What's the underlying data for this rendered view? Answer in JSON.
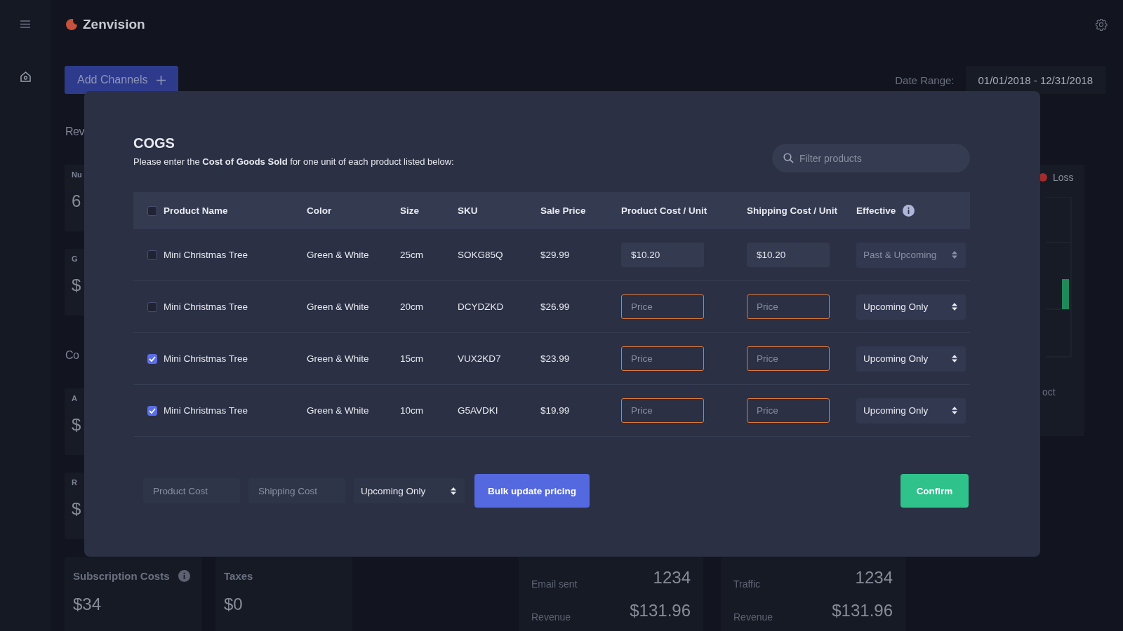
{
  "brand": "Zenvision",
  "toolbar": {
    "add_button": "Add Channels",
    "date_label": "Date Range:",
    "date_value": "01/01/2018 - 12/31/2018"
  },
  "left_column": [
    {
      "kind": "heading",
      "text": "Rev"
    },
    {
      "kind": "card",
      "label": "Nu",
      "value": "6"
    },
    {
      "kind": "card",
      "label": "G",
      "value": "$"
    },
    {
      "kind": "heading",
      "text": "Co"
    },
    {
      "kind": "card",
      "label": "A",
      "value": "$"
    },
    {
      "kind": "card",
      "label": "R",
      "value": "$"
    }
  ],
  "right_card": {
    "legend": "Loss",
    "axis_label": "oct"
  },
  "bottom_cards": [
    {
      "kind": "single",
      "title": "Subscription Costs",
      "info": true,
      "value": "$34"
    },
    {
      "kind": "single",
      "title": "Taxes",
      "info": false,
      "value": "$0"
    },
    {
      "kind": "pair",
      "label_1": "Email sent",
      "value_1": "1234",
      "label_2": "Revenue",
      "value_2": "$131.96"
    },
    {
      "kind": "pair",
      "label_1": "Traffic",
      "value_1": "1234",
      "label_2": "Revenue",
      "value_2": "$131.96"
    }
  ],
  "modal": {
    "title": "COGS",
    "subtitle": "Please enter the **Cost of Goods Sold** for one unit of each product listed below:",
    "filter_placeholder": "Filter products",
    "header_checked": false,
    "columns": [
      {
        "label": "Product Name",
        "info": false
      },
      {
        "label": "Color",
        "info": false
      },
      {
        "label": "Size",
        "info": false
      },
      {
        "label": "SKU",
        "info": false
      },
      {
        "label": "Sale Price",
        "info": false
      },
      {
        "label": "Product Cost / Unit",
        "info": false
      },
      {
        "label": "Shipping Cost / Unit",
        "info": false
      },
      {
        "label": "Effective",
        "info": true
      }
    ],
    "rows": [
      {
        "selected": false,
        "name": "Mini Christmas Tree",
        "color_label": "Green & White",
        "size": "25cm",
        "sku": "SOKG85Q",
        "sale_price": "$29.99",
        "product_cost": {
          "value": "$10.20",
          "invalid": false
        },
        "shipping_cost": {
          "value": "$10.20",
          "invalid": false
        },
        "effective": {
          "value": "Past & Upcoming",
          "disabled": true
        }
      },
      {
        "selected": false,
        "name": "Mini Christmas Tree",
        "color_label": "Green & White",
        "size": "20cm",
        "sku": "DCYDZKD",
        "sale_price": "$26.99",
        "product_cost": {
          "placeholder": "Price",
          "invalid": true
        },
        "shipping_cost": {
          "placeholder": "Price",
          "invalid": true
        },
        "effective": {
          "value": "Upcoming Only",
          "disabled": false
        }
      },
      {
        "selected": true,
        "name": "Mini Christmas Tree",
        "color_label": "Green & White",
        "size": "15cm",
        "sku": "VUX2KD7",
        "sale_price": "$23.99",
        "product_cost": {
          "placeholder": "Price",
          "invalid": true
        },
        "shipping_cost": {
          "placeholder": "Price",
          "invalid": true
        },
        "effective": {
          "value": "Upcoming Only",
          "disabled": false
        }
      },
      {
        "selected": true,
        "name": "Mini Christmas Tree",
        "color_label": "Green & White",
        "size": "10cm",
        "sku": "G5AVDKI",
        "sale_price": "$19.99",
        "product_cost": {
          "placeholder": "Price",
          "invalid": true
        },
        "shipping_cost": {
          "placeholder": "Price",
          "invalid": true
        },
        "effective": {
          "value": "Upcoming Only",
          "disabled": false
        }
      }
    ],
    "bulk": {
      "product_cost_placeholder": "Product Cost",
      "shipping_cost_placeholder": "Shipping Cost",
      "effective": "Upcoming Only",
      "button": "Bulk update pricing"
    },
    "confirm": "Confirm"
  }
}
